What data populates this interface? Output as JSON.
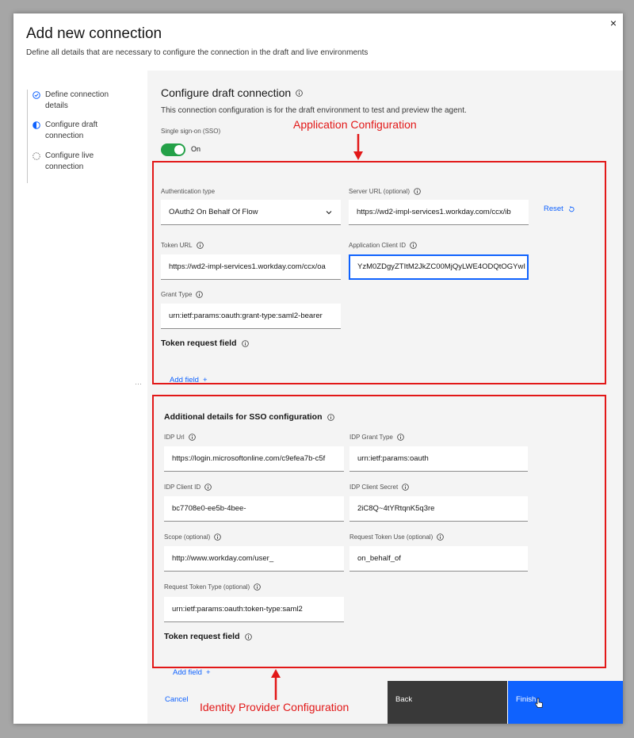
{
  "modal": {
    "title": "Add new connection",
    "subtitle": "Define all details that are necessary to configure the connection in the draft and live environments",
    "close_symbol": "×"
  },
  "steps": [
    {
      "label": "Define connection details",
      "state": "complete"
    },
    {
      "label": "Configure draft connection",
      "state": "current"
    },
    {
      "label": "Configure live connection",
      "state": "incomplete"
    }
  ],
  "draft": {
    "title": "Configure draft connection",
    "description": "This connection configuration is for the draft environment to test and preview the agent.",
    "sso_label": "Single sign-on (SSO)",
    "sso_state": "On"
  },
  "app_config": {
    "auth_type_label": "Authentication type",
    "auth_type_value": "OAuth2 On Behalf Of Flow",
    "server_url_label": "Server URL (optional)",
    "server_url_value": "https://wd2-impl-services1.workday.com/ccx/ib",
    "reset_label": "Reset",
    "token_url_label": "Token URL",
    "token_url_value": "https://wd2-impl-services1.workday.com/ccx/oa",
    "client_id_label": "Application Client ID",
    "client_id_value": "YzM0ZDgyZTItM2JkZC00MjQyLWE4ODQtOGYwI",
    "grant_type_label": "Grant Type",
    "grant_type_value": "urn:ietf:params:oauth:grant-type:saml2-bearer",
    "token_request_field": "Token request field",
    "add_field": "Add field"
  },
  "sso_config": {
    "title": "Additional details for SSO configuration",
    "idp_url_label": "IDP Url",
    "idp_url_value": "https://login.microsoftonline.com/c9efea7b-c5f",
    "idp_grant_type_label": "IDP Grant Type",
    "idp_grant_type_value": "urn:ietf:params:oauth",
    "idp_client_id_label": "IDP Client ID",
    "idp_client_id_value": "bc7708e0-ee5b-4bee-",
    "idp_client_secret_label": "IDP Client Secret",
    "idp_client_secret_value": "2iC8Q~4tYRtqnK5q3re",
    "scope_label": "Scope (optional)",
    "scope_value": "http://www.workday.com/user_",
    "request_token_use_label": "Request Token Use (optional)",
    "request_token_use_value": "on_behalf_of",
    "request_token_type_label": "Request Token Type (optional)",
    "request_token_type_value": "urn:ietf:params:oauth:token-type:saml2",
    "token_request_field": "Token request field",
    "add_field": "Add field"
  },
  "annotations": {
    "app_config": "Application Configuration",
    "idp_config": "Identity Provider Configuration"
  },
  "footer": {
    "cancel": "Cancel",
    "back": "Back",
    "finish": "Finish"
  },
  "colors": {
    "primary": "#0f62fe",
    "toggle_on": "#24a148",
    "annotation_red": "#e21818",
    "back_button": "#393939"
  }
}
